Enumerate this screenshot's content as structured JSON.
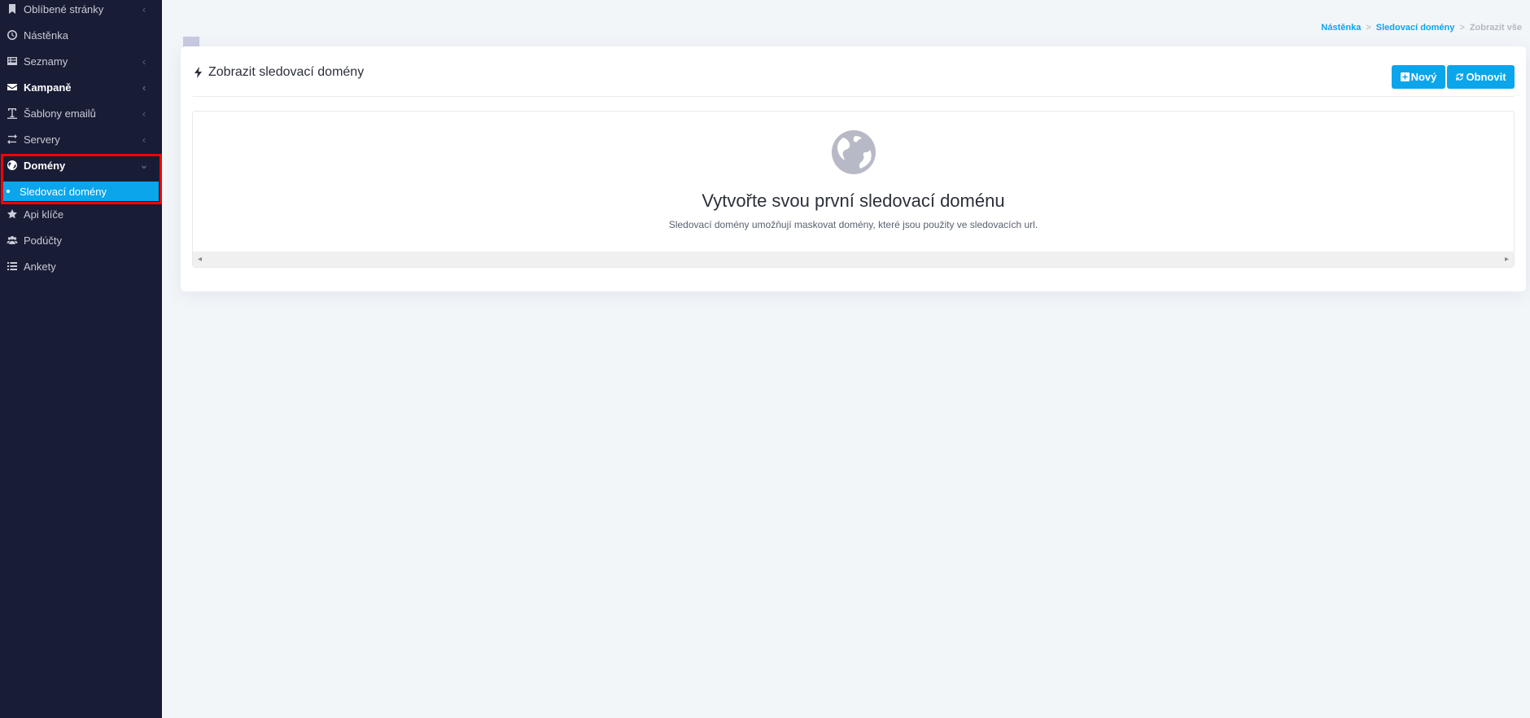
{
  "sidebar": {
    "items": [
      {
        "label": "Oblíbené stránky",
        "icon": "bookmark-icon",
        "chevron": "‹"
      },
      {
        "label": "Nástěnka",
        "icon": "dashboard-icon",
        "chevron": ""
      },
      {
        "label": "Seznamy",
        "icon": "list-table-icon",
        "chevron": "‹"
      },
      {
        "label": "Kampaně",
        "icon": "envelope-icon",
        "chevron": "‹"
      },
      {
        "label": "Šablony emailů",
        "icon": "text-template-icon",
        "chevron": "‹"
      },
      {
        "label": "Servery",
        "icon": "exchange-icon",
        "chevron": "‹"
      },
      {
        "label": "Domény",
        "icon": "globe-icon",
        "chevron": "⌄"
      },
      {
        "label": "Api klíče",
        "icon": "star-icon",
        "chevron": ""
      },
      {
        "label": "Podúčty",
        "icon": "users-icon",
        "chevron": ""
      },
      {
        "label": "Ankety",
        "icon": "list-icon",
        "chevron": ""
      }
    ],
    "active_subitem": "Sledovací domény"
  },
  "breadcrumb": {
    "home": "Nástěnka",
    "section": "Sledovací domény",
    "current": "Zobrazit vše"
  },
  "page": {
    "title": "Zobrazit sledovací domény",
    "new_label": "Nový",
    "refresh_label": "Obnovit"
  },
  "empty_state": {
    "title": "Vytvořte svou první sledovací doménu",
    "description": "Sledovací domény umožňují maskovat domény, které jsou použity ve sledovacích url.",
    "scroll_left": "◂",
    "scroll_right": "▸"
  },
  "colors": {
    "sidebar_bg": "#181c35",
    "accent": "#0ba5ec",
    "page_bg": "#f3f6f9",
    "highlight": "#ff0000"
  }
}
